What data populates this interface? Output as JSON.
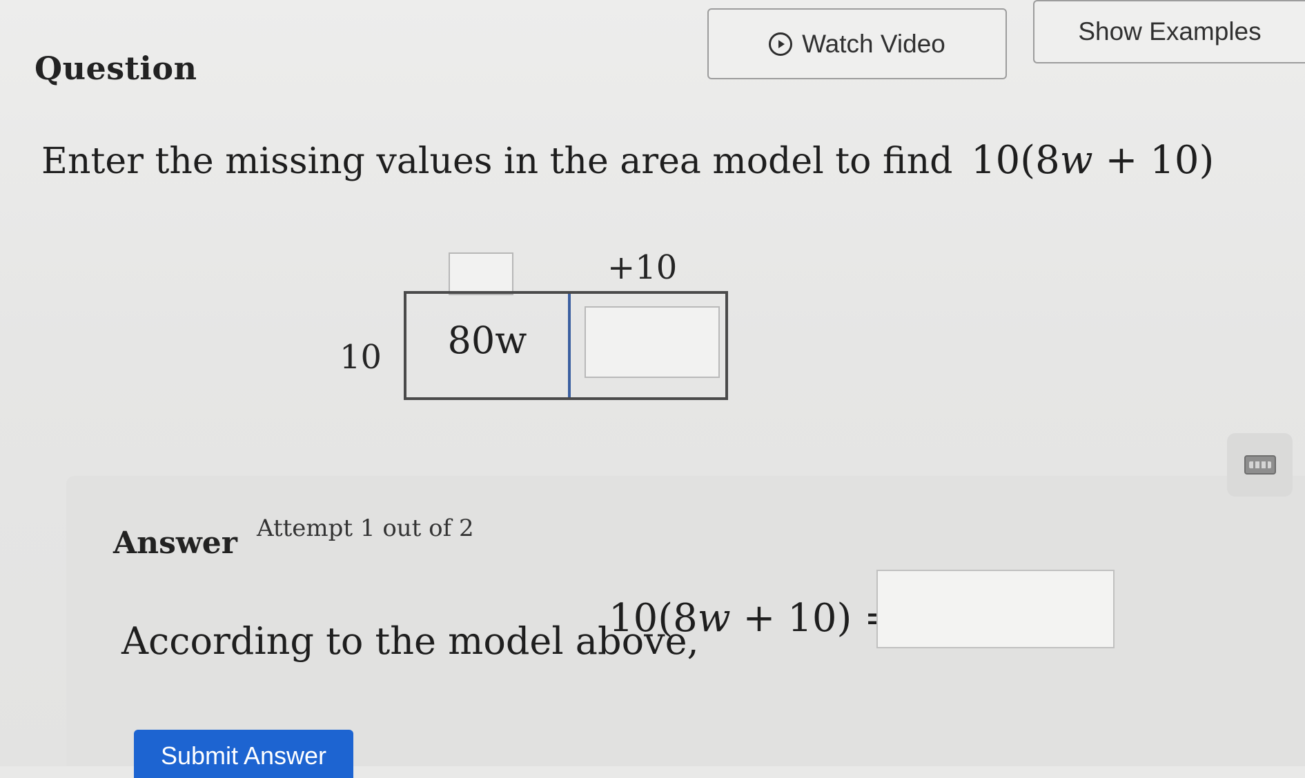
{
  "header": {
    "title": "Question",
    "watch_video_label": "Watch Video",
    "show_examples_label": "Show Examples"
  },
  "question": {
    "prompt": "Enter the missing values in the area model to find",
    "expression": {
      "coef": "10",
      "open": "(",
      "inner_coef": "8",
      "var": "w",
      "plus": " + ",
      "const": "10",
      "close": ")"
    }
  },
  "area_model": {
    "top_right_label": "+10",
    "side_label": "10",
    "known_cell": "80w",
    "top_left_input_value": "",
    "right_cell_input_value": ""
  },
  "answer": {
    "label": "Answer",
    "attempt_text": "Attempt 1 out of 2",
    "sentence": "According to the model above,",
    "equation": {
      "coef": "10",
      "open": "(",
      "inner_coef": "8",
      "var": "w",
      "plus": " + ",
      "const": "10",
      "close": ")",
      "equals": " ="
    },
    "input_value": "",
    "submit_label": "Submit Answer"
  },
  "icons": {
    "play": "play-circle-icon",
    "keypad": "keypad-icon"
  }
}
